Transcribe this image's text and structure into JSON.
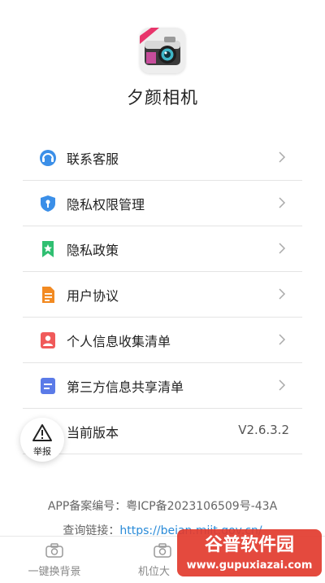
{
  "app": {
    "name": "夕颜相机"
  },
  "menu": [
    {
      "label": "联系客服",
      "icon": "headset-icon",
      "color": "#3b8fe8"
    },
    {
      "label": "隐私权限管理",
      "icon": "shield-key-icon",
      "color": "#3b8fe8"
    },
    {
      "label": "隐私政策",
      "icon": "bookmark-star-icon",
      "color": "#2fbf71"
    },
    {
      "label": "用户协议",
      "icon": "document-icon",
      "color": "#f28a22"
    },
    {
      "label": "个人信息收集清单",
      "icon": "person-card-icon",
      "color": "#f05a5a"
    },
    {
      "label": "第三方信息共享清单",
      "icon": "list-doc-icon",
      "color": "#5b7be8"
    },
    {
      "label": "当前版本",
      "value": "V2.6.3.2"
    }
  ],
  "report": {
    "label": "举报"
  },
  "footer": {
    "icp": "APP备案编号：粤ICP备2023106509号-43A",
    "query_label": "查询链接：",
    "query_link": "https://beian.miit.gov.cn/"
  },
  "tabs": [
    {
      "label": "一键换背景"
    },
    {
      "label": "机位大"
    }
  ],
  "watermark": {
    "brand": "谷普软件园",
    "url": "www.gupuxiazai.com"
  }
}
